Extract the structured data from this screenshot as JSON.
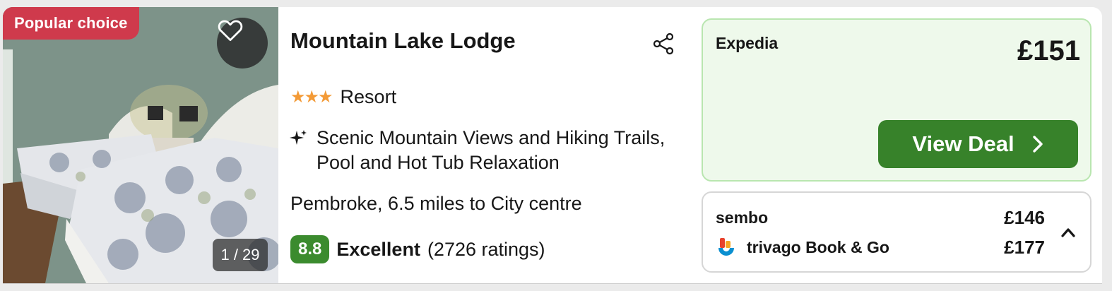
{
  "listing": {
    "popular_badge": "Popular choice",
    "photo_counter": "1 / 29",
    "name": "Mountain Lake Lodge",
    "stars_display": "★★★",
    "star_count": 3,
    "property_type": "Resort",
    "highlight": "Scenic Mountain Views and Hiking Trails, Pool and Hot Tub Relaxation",
    "location": "Pembroke, 6.5 miles to City centre",
    "rating": {
      "score": "8.8",
      "label": "Excellent",
      "count": "(2726 ratings)"
    }
  },
  "top_deal": {
    "provider": "Expedia",
    "price": "£151",
    "button_label": "View Deal"
  },
  "other_offers": [
    {
      "provider": "sembo",
      "price": "£146"
    },
    {
      "provider": "trivago Book & Go",
      "price": "£177"
    }
  ],
  "colors": {
    "popular_badge": "#cf3a4c",
    "stars": "#f39a36",
    "rating_badge": "#3b8b2e",
    "deal_background": "#eef9eb",
    "deal_border": "#b9e6b0",
    "view_deal_button": "#37822a"
  },
  "icons": {
    "favorite": "heart-icon",
    "share": "share-icon",
    "highlight": "sparkle-icon",
    "view_deal": "chevron-right-icon",
    "collapse": "chevron-up-icon",
    "offer_logo": "trivago-logo-icon"
  }
}
